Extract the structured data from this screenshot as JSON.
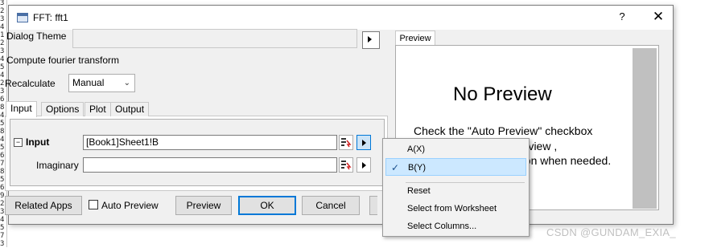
{
  "ruler_digits": [
    "3",
    "2",
    "3",
    "4",
    "1",
    "2",
    "3",
    "4",
    "5",
    "4",
    "2",
    "3",
    "6",
    "8",
    "4",
    "5",
    "8",
    "4",
    "5",
    "6",
    "7",
    "8",
    "5",
    "6",
    "9",
    "2",
    "3",
    "4",
    "5",
    "7",
    "3"
  ],
  "dialog": {
    "title": "FFT: fft1",
    "help": "?",
    "close": "✕",
    "theme_label": "Dialog Theme",
    "description": "Compute fourier transform",
    "recalculate_label": "Recalculate",
    "recalculate_value": "Manual",
    "tabs": [
      "Input",
      "Options",
      "Plot",
      "Output"
    ],
    "input_label": "Input",
    "input_value": "[Book1]Sheet1!B",
    "imaginary_label": "Imaginary",
    "imaginary_value": "",
    "buttons": {
      "related_apps": "Related Apps",
      "auto_preview": "Auto Preview",
      "preview": "Preview",
      "ok": "OK",
      "cancel": "Cancel"
    }
  },
  "preview_panel": {
    "tab": "Preview",
    "title": "No Preview",
    "line1": "Check the \"Auto Preview\" checkbox",
    "line2": "review ,",
    "line3": "tton when needed."
  },
  "context_menu": {
    "items": [
      "A(X)",
      "B(Y)",
      "Reset",
      "Select from Worksheet",
      "Select Columns..."
    ],
    "checked_index": 1
  },
  "watermark": "CSDN @GUNDAM_EXIA_",
  "colors": {
    "accent": "#0078d7",
    "menu_highlight": "#cce8ff"
  }
}
